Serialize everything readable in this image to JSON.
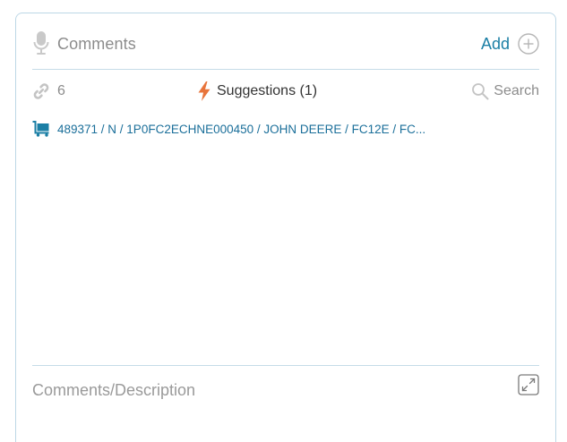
{
  "comments_panel": {
    "title": "Comments",
    "add_label": "Add",
    "icons": {
      "header": "microphone-icon",
      "add": "plus-circle-icon",
      "links": "link-icon",
      "suggestions": "lightning-bolt-icon",
      "search": "search-icon",
      "suggestion_item": "cart-icon",
      "expand": "expand-icon"
    },
    "colors": {
      "accent": "#1b7fa5",
      "link_text": "#1b6f9a",
      "bolt": "#e8743b",
      "muted": "#8c8c8c",
      "border": "#bcd7e6"
    }
  },
  "toolbar": {
    "links_count": "6",
    "suggestions_label": "Suggestions (1)",
    "search_label": "Search"
  },
  "suggestions": [
    {
      "text": "489371 / N / 1P0FC2ECHNE000450 / JOHN DEERE / FC12E / FC..."
    }
  ],
  "description": {
    "placeholder": "Comments/Description",
    "value": ""
  }
}
